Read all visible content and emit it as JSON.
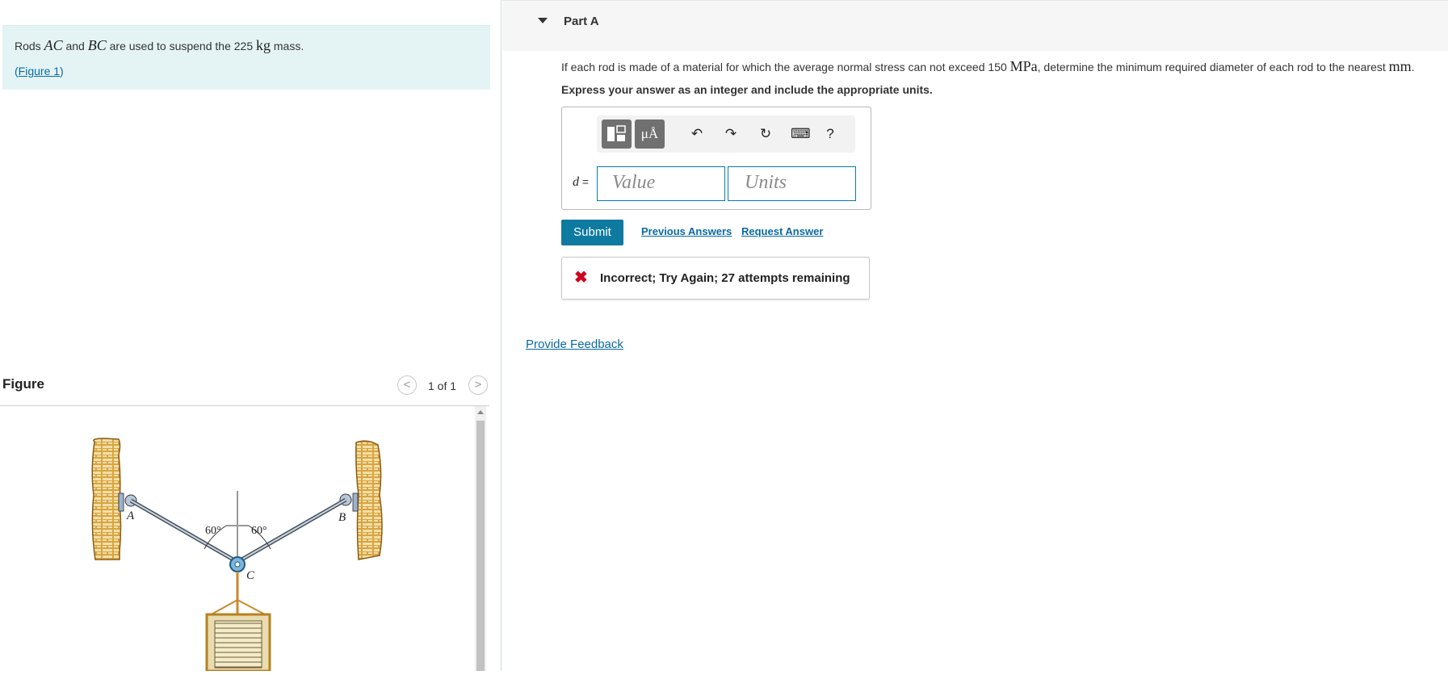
{
  "problem": {
    "text_before": "Rods ",
    "rod1": "AC",
    "text_and": " and ",
    "rod2": "BC",
    "text_mid": " are used to suspend the 225 ",
    "mass_unit": "kg",
    "text_after": " mass.",
    "figure_link_label": "Figure 1"
  },
  "figure_panel": {
    "title": "Figure",
    "pager_prev": "<",
    "pager_next": ">",
    "pager_count": "1 of 1",
    "labels": {
      "a": "A",
      "b": "B",
      "c": "C",
      "angle_left": "60°",
      "angle_right": "60°"
    }
  },
  "part": {
    "title": "Part A",
    "question_before": "If each rod is made of a material for which the average normal stress can not exceed 150 ",
    "stress_unit": "MPa",
    "question_after": ", determine the minimum required diameter of each rod to the nearest ",
    "length_unit": "mm",
    "question_end": ".",
    "instruction": "Express your answer as an integer and include the appropriate units."
  },
  "answer": {
    "variable": "d",
    "equals": " =",
    "value_placeholder": "Value",
    "units_placeholder": "Units",
    "toolbar": {
      "units_button": "μÅ",
      "undo": "↶",
      "redo": "↷",
      "reset": "↻",
      "keyboard": "⌨",
      "help": "?"
    },
    "icons": [
      "templates-icon",
      "units-icon",
      "undo-icon",
      "redo-icon",
      "reset-icon",
      "keyboard-icon",
      "help-icon"
    ]
  },
  "actions": {
    "submit": "Submit",
    "previous_answers": "Previous Answers",
    "request_answer": "Request Answer"
  },
  "feedback": {
    "icon": "✖",
    "message": "Incorrect; Try Again; 27 attempts remaining"
  },
  "provide_feedback": "Provide Feedback",
  "colors": {
    "accent": "#0e7aa0",
    "link": "#0a6aa1",
    "error": "#d0021b",
    "problem_bg": "#e4f4f4"
  }
}
